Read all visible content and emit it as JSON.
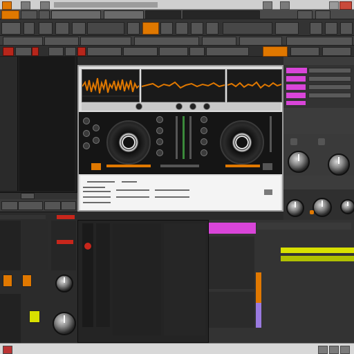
{
  "window": {
    "title_bar": "",
    "accent": "#e07800"
  },
  "status_bar": {
    "text": ""
  },
  "colors": {
    "orange": "#e07800",
    "magenta": "#d945d9",
    "yellow": "#d8e000",
    "red": "#c8261b"
  },
  "icons": [
    "app-icon",
    "close-icon",
    "minimize-icon",
    "play-icon",
    "record-icon",
    "knob-icon"
  ]
}
